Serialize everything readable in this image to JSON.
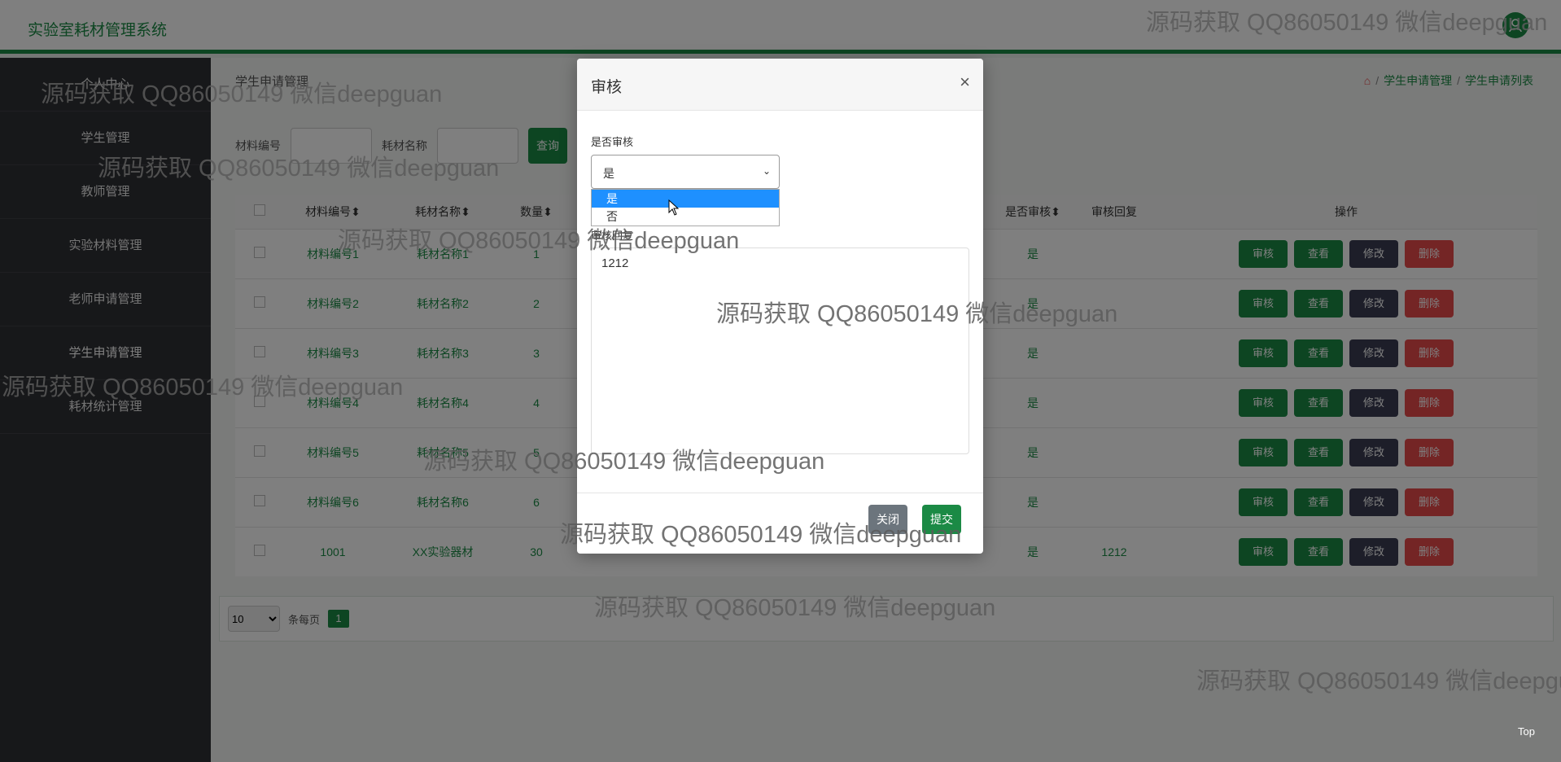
{
  "app": {
    "title": "实验室耗材管理系统"
  },
  "sidebar": {
    "items": [
      {
        "label": "个人中心"
      },
      {
        "label": "学生管理"
      },
      {
        "label": "教师管理"
      },
      {
        "label": "实验材料管理"
      },
      {
        "label": "老师申请管理"
      },
      {
        "label": "学生申请管理"
      },
      {
        "label": "耗材统计管理"
      }
    ]
  },
  "page": {
    "title": "学生申请管理",
    "breadcrumb": [
      "学生申请管理",
      "学生申请列表"
    ]
  },
  "search": {
    "field1_label": "材料编号",
    "field2_label": "耗材名称",
    "query_button": "查询"
  },
  "table": {
    "headers": [
      "材料编号",
      "耗材名称",
      "数量",
      "是否审核",
      "审核回复",
      "操作"
    ],
    "rows": [
      {
        "code": "材料编号1",
        "name": "耗材名称1",
        "qty": "1",
        "audited": "是",
        "reply": ""
      },
      {
        "code": "材料编号2",
        "name": "耗材名称2",
        "qty": "2",
        "audited": "是",
        "reply": ""
      },
      {
        "code": "材料编号3",
        "name": "耗材名称3",
        "qty": "3",
        "audited": "是",
        "reply": ""
      },
      {
        "code": "材料编号4",
        "name": "耗材名称4",
        "qty": "4",
        "audited": "是",
        "reply": ""
      },
      {
        "code": "材料编号5",
        "name": "耗材名称5",
        "qty": "5",
        "audited": "是",
        "reply": ""
      },
      {
        "code": "材料编号6",
        "name": "耗材名称6",
        "qty": "6",
        "audited": "是",
        "reply": ""
      },
      {
        "code": "1001",
        "name": "XX实验器材",
        "qty": "30",
        "audited": "是",
        "reply": "1212"
      }
    ],
    "actions": {
      "audit": "审核",
      "view": "查看",
      "edit": "修改",
      "delete": "删除"
    }
  },
  "pager": {
    "page_size": "10",
    "per_page_label": "条每页",
    "current_page": "1"
  },
  "top_link": "Top",
  "modal": {
    "title": "审核",
    "close_glyph": "×",
    "audit_label": "是否审核",
    "selected": "是",
    "options": [
      "是",
      "否"
    ],
    "reply_label": "审核回复",
    "reply_value": "1212",
    "close_button": "关闭",
    "submit_button": "提交"
  },
  "watermark": "源码获取 QQ86050149 微信deepguan",
  "colors": {
    "brand": "#1b8a45",
    "danger": "#e84b4b",
    "edit": "#3a3d52",
    "sidebar": "#2f3034"
  }
}
